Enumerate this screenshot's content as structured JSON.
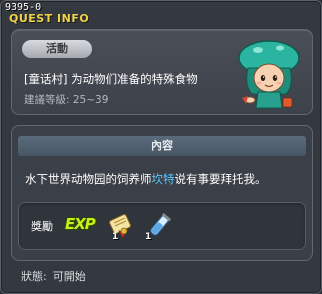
{
  "window": {
    "quest_id": "9395-0",
    "title": "QUEST INFO"
  },
  "quest": {
    "category": "活動",
    "name": "[童话村] 为动物们准备的特殊食物",
    "level_range": "建議等級: 25~39",
    "npc_icon": "mushroom-hat-npc-icon"
  },
  "content": {
    "header": "內容",
    "description_before": "水下世界动物园的饲养师",
    "description_highlight": "坎特",
    "description_after": "说有事要拜托我。"
  },
  "rewards": {
    "label": "獎勵",
    "items": [
      {
        "icon": "exp-icon",
        "text": "EXP"
      },
      {
        "icon": "scroll-icon",
        "quantity": "1"
      },
      {
        "icon": "potion-vial-icon",
        "quantity": "1"
      }
    ]
  },
  "status": {
    "label": "狀態:",
    "value": "可開始"
  },
  "colors": {
    "title": "#f0d34a",
    "highlight": "#5cc8ff",
    "exp": "#c8ee1c"
  }
}
